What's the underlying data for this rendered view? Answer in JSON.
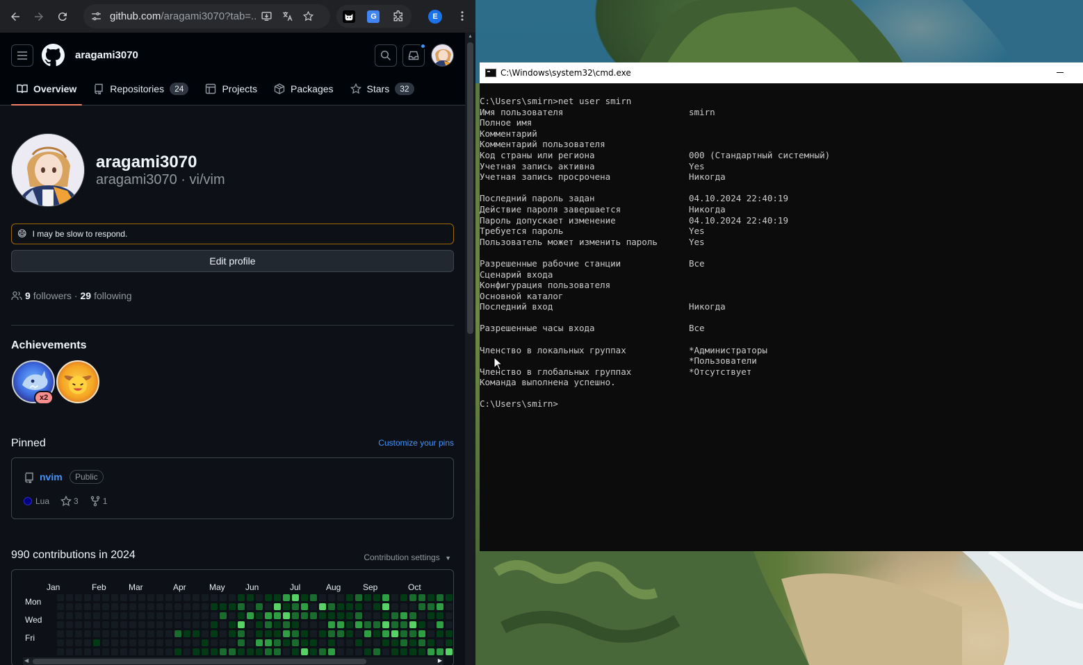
{
  "browser": {
    "url_main": "github.com",
    "url_rest": "/aragami3070?tab=...",
    "profile_initial": "E"
  },
  "github": {
    "username": "aragami3070",
    "tabs": [
      {
        "label": "Overview",
        "count": null
      },
      {
        "label": "Repositories",
        "count": "24"
      },
      {
        "label": "Projects",
        "count": null
      },
      {
        "label": "Packages",
        "count": null
      },
      {
        "label": "Stars",
        "count": "32"
      }
    ],
    "profile": {
      "name": "aragami3070",
      "login_line": "aragami3070 · vi/vim",
      "status_emoji": "😄",
      "status_text": "I may be slow to respond.",
      "edit_label": "Edit profile",
      "followers": "9",
      "followers_label": "followers",
      "separator": " · ",
      "following": "29",
      "following_label": "following"
    },
    "achievements": {
      "title": "Achievements",
      "multiplier": "x2"
    },
    "pinned": {
      "title": "Pinned",
      "customize": "Customize your pins",
      "repo": {
        "name": "nvim",
        "visibility": "Public",
        "language": "Lua",
        "language_color": "#000080",
        "stars": "3",
        "forks": "1"
      }
    },
    "contributions": {
      "title": "990 contributions in 2024",
      "settings": "Contribution settings",
      "months": [
        "Jan",
        "Feb",
        "Mar",
        "Apr",
        "May",
        "Jun",
        "Jul",
        "Aug",
        "Sep",
        "Oct"
      ],
      "days": [
        "Mon",
        "Wed",
        "Fri"
      ]
    }
  },
  "cmd": {
    "title": "C:\\Windows\\system32\\cmd.exe",
    "command_line": "C:\\Users\\smirn>net user smirn",
    "rows": [
      {
        "k": "Имя пользователя",
        "v": "smirn"
      },
      {
        "k": "Полное имя",
        "v": ""
      },
      {
        "k": "Комментарий",
        "v": ""
      },
      {
        "k": "Комментарий пользователя",
        "v": ""
      },
      {
        "k": "Код страны или региона",
        "v": "000 (Стандартный системный)"
      },
      {
        "k": "Учетная запись активна",
        "v": "Yes"
      },
      {
        "k": "Учетная запись просрочена",
        "v": "Никогда"
      },
      {
        "k": "",
        "v": ""
      },
      {
        "k": "Последний пароль задан",
        "v": "04.10.2024 22:40:19"
      },
      {
        "k": "Действие пароля завершается",
        "v": "Никогда"
      },
      {
        "k": "Пароль допускает изменение",
        "v": "04.10.2024 22:40:19"
      },
      {
        "k": "Требуется пароль",
        "v": "Yes"
      },
      {
        "k": "Пользователь может изменить пароль",
        "v": "Yes"
      },
      {
        "k": "",
        "v": ""
      },
      {
        "k": "Разрешенные рабочие станции",
        "v": "Все"
      },
      {
        "k": "Сценарий входа",
        "v": ""
      },
      {
        "k": "Конфигурация пользователя",
        "v": ""
      },
      {
        "k": "Основной каталог",
        "v": ""
      },
      {
        "k": "Последний вход",
        "v": "Никогда"
      },
      {
        "k": "",
        "v": ""
      },
      {
        "k": "Разрешенные часы входа",
        "v": "Все"
      },
      {
        "k": "",
        "v": ""
      },
      {
        "k": "Членство в локальных группах",
        "v": "*Администраторы"
      },
      {
        "k": "",
        "v": "*Пользователи"
      },
      {
        "k": "Членство в глобальных группах",
        "v": "*Отсутствует"
      },
      {
        "k": "Команда выполнена успешно.",
        "v": ""
      }
    ],
    "prompt": "C:\\Users\\smirn>"
  }
}
